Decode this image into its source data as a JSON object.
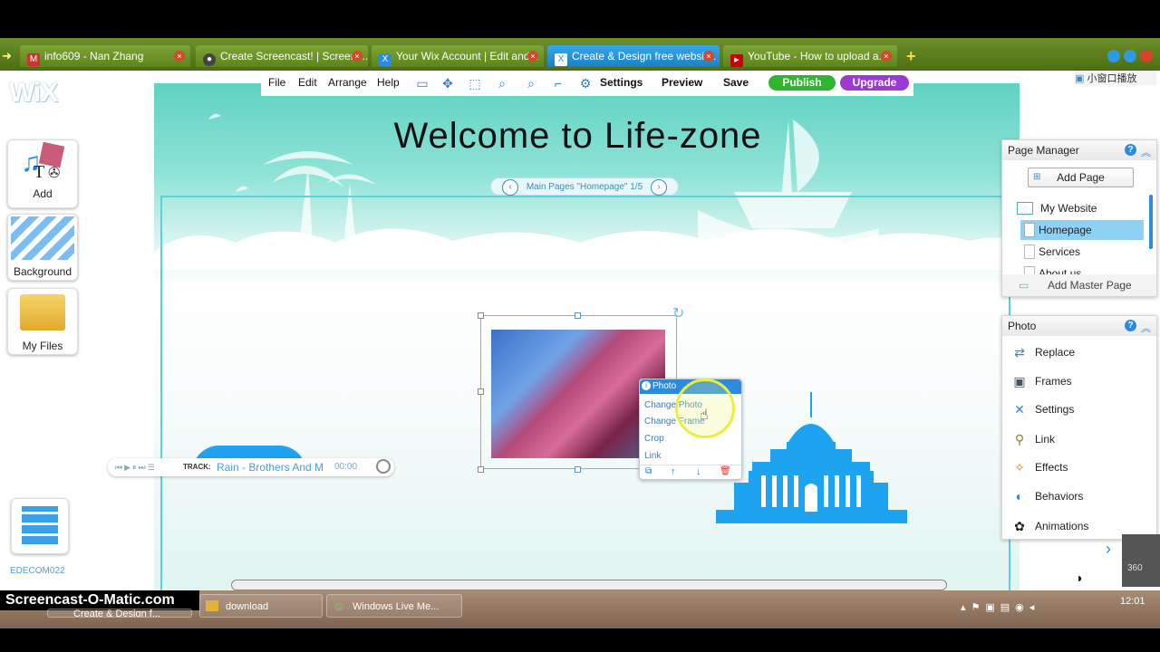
{
  "browser": {
    "tabs": [
      {
        "label": "info609 - Nan Zhang",
        "favicon": "gmail-icon"
      },
      {
        "label": "Create Screencast! | Screenc...",
        "favicon": "screencast-icon"
      },
      {
        "label": "Your Wix Account | Edit and...",
        "favicon": "wix-icon"
      },
      {
        "label": "Create & Design free websit...",
        "favicon": "wix-icon",
        "active": true
      },
      {
        "label": "YouTube - How to upload a...",
        "favicon": "youtube-icon"
      }
    ],
    "small_window_label": "小窗口播放"
  },
  "toolbar": {
    "file": "File",
    "edit": "Edit",
    "arrange": "Arrange",
    "help": "Help",
    "settings": "Settings",
    "preview": "Preview",
    "save": "Save",
    "publish": "Publish",
    "upgrade": "Upgrade"
  },
  "logo": "WiX",
  "left_panel": {
    "add": "Add",
    "background": "Background",
    "my_files": "My Files",
    "footer_label": "EDECOM022"
  },
  "site": {
    "title": "Welcome to Life-zone",
    "pages_nav": "Main Pages \"Homepage\" 1/5"
  },
  "page_manager": {
    "title": "Page Manager",
    "add_page": "Add Page",
    "items": [
      "My Website",
      "Homepage",
      "Services",
      "About us"
    ],
    "add_master": "Add Master Page"
  },
  "photo_panel": {
    "title": "Photo",
    "items": [
      {
        "label": "Replace",
        "icon": "replace-icon"
      },
      {
        "label": "Frames",
        "icon": "frames-icon"
      },
      {
        "label": "Settings",
        "icon": "settings-icon"
      },
      {
        "label": "Link",
        "icon": "link-icon"
      },
      {
        "label": "Effects",
        "icon": "effects-icon"
      },
      {
        "label": "Behaviors",
        "icon": "behaviors-icon"
      },
      {
        "label": "Animations",
        "icon": "animations-icon"
      }
    ]
  },
  "context_menu": {
    "title": "Photo",
    "items": [
      "Change Photo",
      "Change Frame",
      "Crop",
      "Link"
    ]
  },
  "player": {
    "track_label": "TRACK:",
    "track_name": "Rain - Brothers And M",
    "time": "00:00"
  },
  "taskbar": {
    "watermark": "Screencast-O-Matic.com",
    "tasks": [
      "Create & Design f...",
      "download",
      "Windows Live Me..."
    ],
    "clock": "12:01",
    "side_label": "360"
  },
  "colors": {
    "accent": "#2c8be0",
    "publish": "#2fb52f",
    "upgrade": "#9b3ad1",
    "frame": "#5ccfe0"
  }
}
